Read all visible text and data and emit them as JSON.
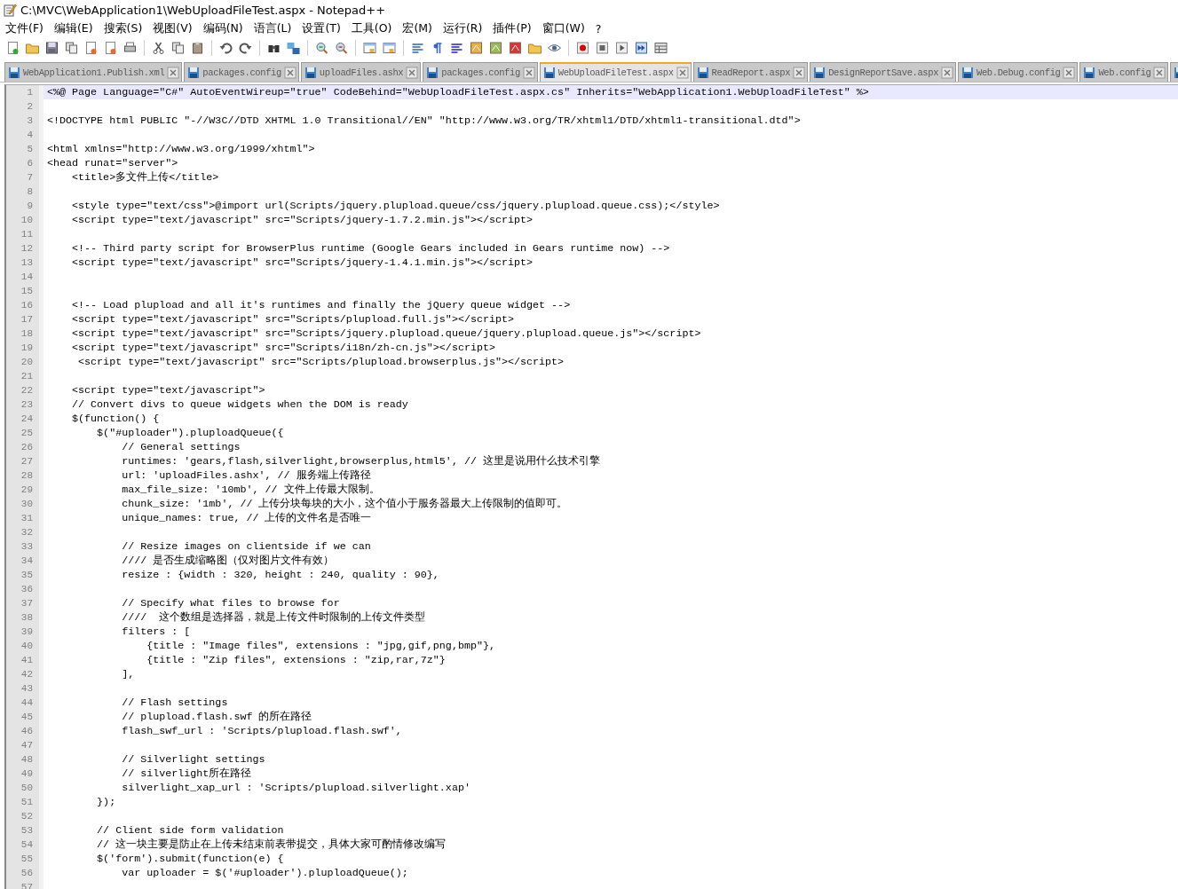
{
  "window": {
    "title": "C:\\MVC\\WebApplication1\\WebUploadFileTest.aspx - Notepad++"
  },
  "menu": [
    "文件(F)",
    "编辑(E)",
    "搜索(S)",
    "视图(V)",
    "编码(N)",
    "语言(L)",
    "设置(T)",
    "工具(O)",
    "宏(M)",
    "运行(R)",
    "插件(P)",
    "窗口(W)",
    "?"
  ],
  "tabs": [
    {
      "label": "WebApplication1.Publish.xml",
      "selected": false
    },
    {
      "label": "packages.config",
      "selected": false
    },
    {
      "label": "uploadFiles.ashx",
      "selected": false
    },
    {
      "label": "packages.config",
      "selected": false
    },
    {
      "label": "WebUploadFileTest.aspx",
      "selected": true
    },
    {
      "label": "ReadReport.aspx",
      "selected": false
    },
    {
      "label": "DesignReportSave.aspx",
      "selected": false
    },
    {
      "label": "Web.Debug.config",
      "selected": false
    },
    {
      "label": "Web.config",
      "selected": false
    },
    {
      "selected": false
    }
  ],
  "editor": {
    "lines": [
      {
        "number": "1",
        "text": "<%@ Page Language=\"C#\" AutoEventWireup=\"true\" CodeBehind=\"WebUploadFileTest.aspx.cs\" Inherits=\"WebApplication1.WebUploadFileTest\" %>",
        "current": true
      },
      {
        "number": "2",
        "current": false
      },
      {
        "number": "3",
        "text": "<!DOCTYPE html PUBLIC \"-//W3C//DTD XHTML 1.0 Transitional//EN\" \"http://www.w3.org/TR/xhtml1/DTD/xhtml1-transitional.dtd\">",
        "current": false
      },
      {
        "number": "4",
        "current": false
      },
      {
        "number": "5",
        "text": "<html xmlns=\"http://www.w3.org/1999/xhtml\">",
        "current": false
      },
      {
        "number": "6",
        "text": "<head runat=\"server\">",
        "current": false
      },
      {
        "number": "7",
        "text": "    <title>多文件上传</title>",
        "current": false
      },
      {
        "number": "8",
        "current": false
      },
      {
        "number": "9",
        "text": "    <style type=\"text/css\">@import url(Scripts/jquery.plupload.queue/css/jquery.plupload.queue.css);</style>",
        "current": false
      },
      {
        "number": "10",
        "text": "    <script type=\"text/javascript\" src=\"Scripts/jquery-1.7.2.min.js\"></script>",
        "current": false
      },
      {
        "number": "11",
        "current": false
      },
      {
        "number": "12",
        "text": "    <!-- Third party script for BrowserPlus runtime (Google Gears included in Gears runtime now) -->",
        "current": false
      },
      {
        "number": "13",
        "text": "    <script type=\"text/javascript\" src=\"Scripts/jquery-1.4.1.min.js\"></script>",
        "current": false
      },
      {
        "number": "14",
        "current": false
      },
      {
        "number": "15",
        "current": false
      },
      {
        "number": "16",
        "text": "    <!-- Load plupload and all it's runtimes and finally the jQuery queue widget -->",
        "current": false
      },
      {
        "number": "17",
        "text": "    <script type=\"text/javascript\" src=\"Scripts/plupload.full.js\"></script>",
        "current": false
      },
      {
        "number": "18",
        "text": "    <script type=\"text/javascript\" src=\"Scripts/jquery.plupload.queue/jquery.plupload.queue.js\"></script>",
        "current": false
      },
      {
        "number": "19",
        "text": "    <script type=\"text/javascript\" src=\"Scripts/i18n/zh-cn.js\"></script>",
        "current": false
      },
      {
        "number": "20",
        "text": "     <script type=\"text/javascript\" src=\"Scripts/plupload.browserplus.js\"></script>",
        "current": false
      },
      {
        "number": "21",
        "current": false
      },
      {
        "number": "22",
        "text": "    <script type=\"text/javascript\">",
        "current": false
      },
      {
        "number": "23",
        "text": "    // Convert divs to queue widgets when the DOM is ready",
        "current": false
      },
      {
        "number": "24",
        "text": "    $(function() {",
        "current": false
      },
      {
        "number": "25",
        "text": "        $(\"#uploader\").pluploadQueue({",
        "current": false
      },
      {
        "number": "26",
        "text": "            // General settings",
        "current": false
      },
      {
        "number": "27",
        "text": "            runtimes: 'gears,flash,silverlight,browserplus,html5', // 这里是说用什么技术引擎",
        "current": false
      },
      {
        "number": "28",
        "text": "            url: 'uploadFiles.ashx', // 服务端上传路径",
        "current": false
      },
      {
        "number": "29",
        "text": "            max_file_size: '10mb', // 文件上传最大限制。",
        "current": false
      },
      {
        "number": "30",
        "text": "            chunk_size: '1mb', // 上传分块每块的大小，这个值小于服务器最大上传限制的值即可。",
        "current": false
      },
      {
        "number": "31",
        "text": "            unique_names: true, // 上传的文件名是否唯一",
        "current": false
      },
      {
        "number": "32",
        "current": false
      },
      {
        "number": "33",
        "text": "            // Resize images on clientside if we can",
        "current": false
      },
      {
        "number": "34",
        "text": "            //// 是否生成缩略图（仅对图片文件有效）",
        "current": false
      },
      {
        "number": "35",
        "text": "            resize : {width : 320, height : 240, quality : 90},",
        "current": false
      },
      {
        "number": "36",
        "current": false
      },
      {
        "number": "37",
        "text": "            // Specify what files to browse for",
        "current": false
      },
      {
        "number": "38",
        "text": "            ////  这个数组是选择器，就是上传文件时限制的上传文件类型",
        "current": false
      },
      {
        "number": "39",
        "text": "            filters : [",
        "current": false
      },
      {
        "number": "40",
        "text": "                {title : \"Image files\", extensions : \"jpg,gif,png,bmp\"},",
        "current": false
      },
      {
        "number": "41",
        "text": "                {title : \"Zip files\", extensions : \"zip,rar,7z\"}",
        "current": false
      },
      {
        "number": "42",
        "text": "            ],",
        "current": false
      },
      {
        "number": "43",
        "current": false
      },
      {
        "number": "44",
        "text": "            // Flash settings",
        "current": false
      },
      {
        "number": "45",
        "text": "            // plupload.flash.swf 的所在路径",
        "current": false
      },
      {
        "number": "46",
        "text": "            flash_swf_url : 'Scripts/plupload.flash.swf',",
        "current": false
      },
      {
        "number": "47",
        "current": false
      },
      {
        "number": "48",
        "text": "            // Silverlight settings",
        "current": false
      },
      {
        "number": "49",
        "text": "            // silverlight所在路径",
        "current": false
      },
      {
        "number": "50",
        "text": "            silverlight_xap_url : 'Scripts/plupload.silverlight.xap'",
        "current": false
      },
      {
        "number": "51",
        "text": "        });",
        "current": false
      },
      {
        "number": "52",
        "current": false
      },
      {
        "number": "53",
        "text": "        // Client side form validation",
        "current": false
      },
      {
        "number": "54",
        "text": "        // 这一块主要是防止在上传未结束前表带提交，具体大家可酌情修改编写",
        "current": false
      },
      {
        "number": "55",
        "text": "        $('form').submit(function(e) {",
        "current": false
      },
      {
        "number": "56",
        "text": "            var uploader = $('#uploader').pluploadQueue();",
        "current": false
      },
      {
        "number": "57",
        "current": false
      }
    ]
  }
}
